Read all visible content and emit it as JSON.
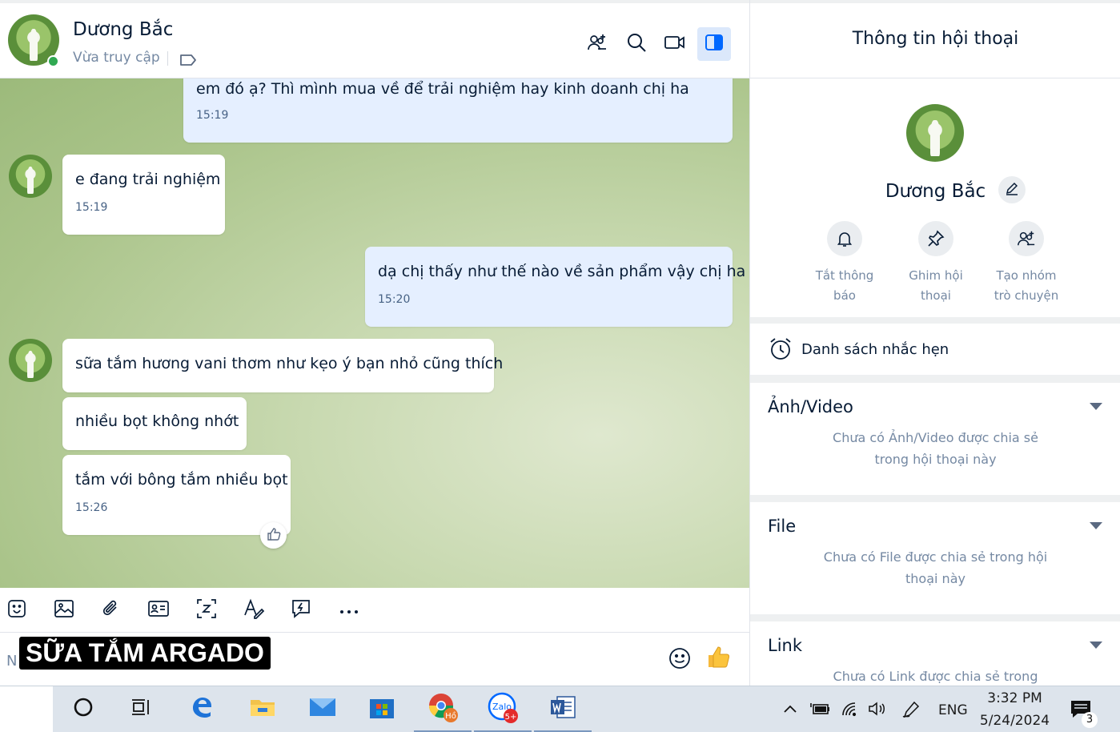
{
  "chat_header": {
    "name": "Dương Bắc",
    "status": "Vừa truy cập"
  },
  "messages": [
    {
      "side": "me",
      "text": "em đó ạ? Thì mình mua về để trải nghiệm hay kinh doanh chị ha",
      "time": "15:19"
    },
    {
      "side": "them",
      "text": "e đang trải nghiệm",
      "time": "15:19"
    },
    {
      "side": "me",
      "text": "dạ chị thấy như thế nào về sản phẩm vậy chị ha",
      "time": "15:20"
    },
    {
      "side": "them",
      "text": "sữa tắm hương vani thơm như kẹo ý bạn nhỏ cũng thích",
      "time": ""
    },
    {
      "side": "them",
      "text": "nhiều bọt không nhớt",
      "time": ""
    },
    {
      "side": "them",
      "text": "tắm với bông tắm nhiều bọt",
      "time": "15:26"
    }
  ],
  "composer": {
    "placeholder_visible": "N",
    "caption": "SỮA TẮM ARGADO"
  },
  "info": {
    "title": "Thông tin hội thoại",
    "name": "Dương Bắc",
    "actions": [
      {
        "label": "Tắt thông\nbáo",
        "icon": "bell-icon"
      },
      {
        "label": "Ghim hội\nthoại",
        "icon": "pin-icon"
      },
      {
        "label": "Tạo nhóm\ntrò chuyện",
        "icon": "add-group-icon"
      }
    ],
    "reminder_label": "Danh sách nhắc hẹn",
    "sections": [
      {
        "title": "Ảnh/Video",
        "empty": "Chưa có Ảnh/Video được chia sẻ trong hội thoại này"
      },
      {
        "title": "File",
        "empty": "Chưa có File được chia sẻ trong hội thoại này"
      },
      {
        "title": "Link",
        "empty": "Chưa có Link được chia sẻ trong"
      }
    ]
  },
  "taskbar": {
    "language": "ENG",
    "time": "3:32 PM",
    "date": "5/24/2024",
    "notification_count": "3",
    "zalo_badge": "5+",
    "chrome_badge": "Hồ",
    "zalo_label": "Zalo"
  },
  "colors": {
    "accent": "#0068ff",
    "my_bubble": "#e5efff",
    "online": "#30a952"
  }
}
